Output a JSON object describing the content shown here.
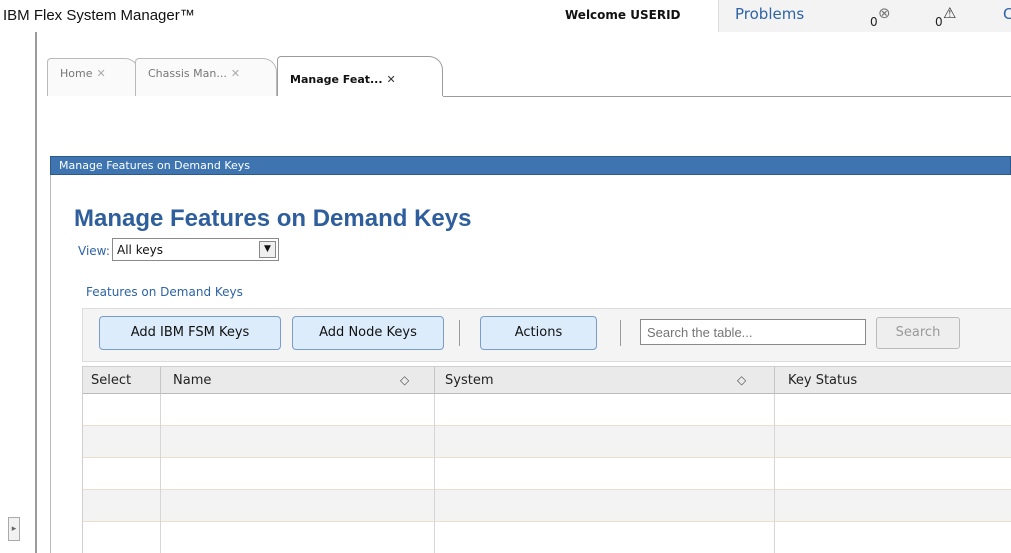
{
  "header": {
    "brand": "IBM Flex System Manager™",
    "welcome": "Welcome USERID",
    "problems": "Problems",
    "error_count": "0",
    "warning_count": "0",
    "error_icon": "circle-x-icon",
    "warning_icon": "warning-triangle-icon",
    "more_label": "C"
  },
  "tabs": [
    {
      "label": "Home",
      "close": "✕"
    },
    {
      "label": "Chassis Man...",
      "close": "✕"
    },
    {
      "label": "Manage Feat...",
      "close": "✕"
    }
  ],
  "portlet": {
    "bar_title": "Manage Features on Demand Keys",
    "page_title": "Manage Features on Demand Keys",
    "view_label": "View:",
    "view_value": "All keys",
    "section_title": "Features on Demand Keys"
  },
  "toolbar": {
    "add_fsm_label": "Add IBM FSM Keys",
    "add_node_label": "Add Node Keys",
    "actions_label": "Actions",
    "search_placeholder": "Search the table...",
    "search_button": "Search"
  },
  "table": {
    "columns": [
      "Select",
      "Name",
      "System",
      "Key Status"
    ],
    "rows": []
  },
  "colors": {
    "accent": "#3e74b0",
    "title": "#2f5e9c",
    "button_bg": "#dcecfb"
  }
}
